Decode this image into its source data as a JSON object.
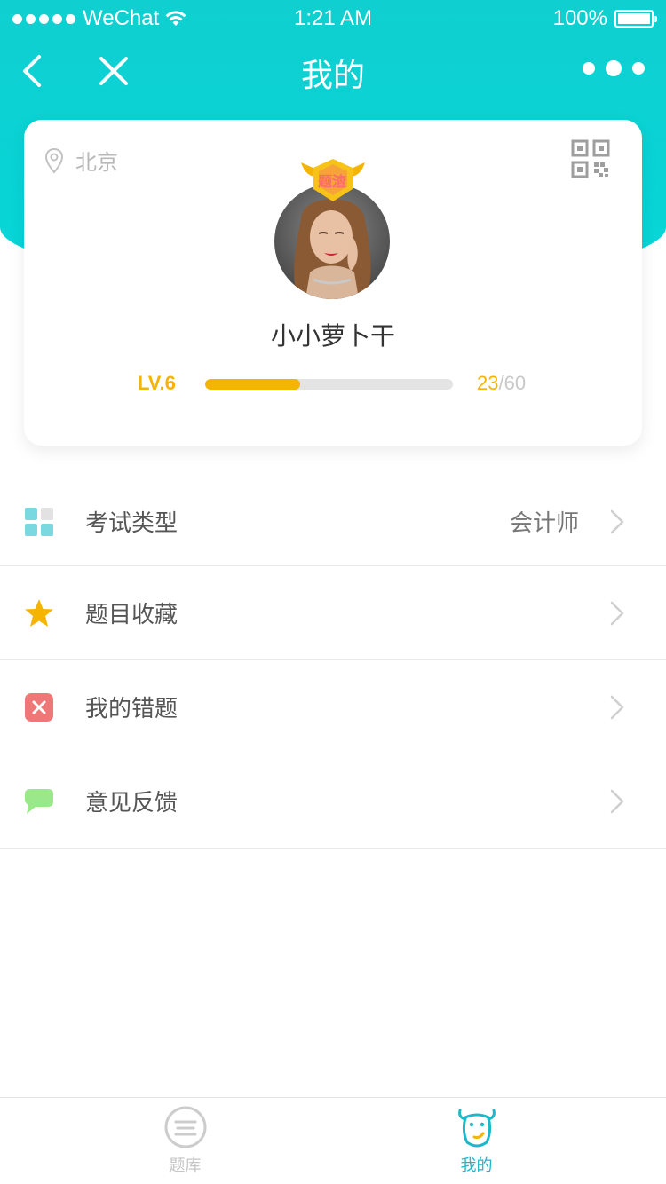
{
  "status_bar": {
    "carrier": "WeChat",
    "time": "1:21 AM",
    "battery": "100%"
  },
  "nav": {
    "title": "我的"
  },
  "profile": {
    "location": "北京",
    "badge_text": "题渣",
    "username": "小小萝卜干",
    "level": "LV.6",
    "progress": {
      "current": "23",
      "separator": "/",
      "max": "60",
      "fraction": 0.383
    }
  },
  "menu": {
    "items": [
      {
        "label": "考试类型",
        "value": "会计师",
        "icon": "grid-icon"
      },
      {
        "label": "题目收藏",
        "value": "",
        "icon": "star-icon"
      },
      {
        "label": "我的错题",
        "value": "",
        "icon": "error-icon"
      },
      {
        "label": "意见反馈",
        "value": "",
        "icon": "feedback-icon"
      }
    ]
  },
  "tabs": [
    {
      "label": "题库",
      "active": false,
      "icon": "question-bank-icon"
    },
    {
      "label": "我的",
      "active": true,
      "icon": "cow-mascot-icon"
    }
  ],
  "colors": {
    "header": "#05d6d8",
    "accent_gold": "#f5b400",
    "tab_active": "#1bb8c8"
  }
}
